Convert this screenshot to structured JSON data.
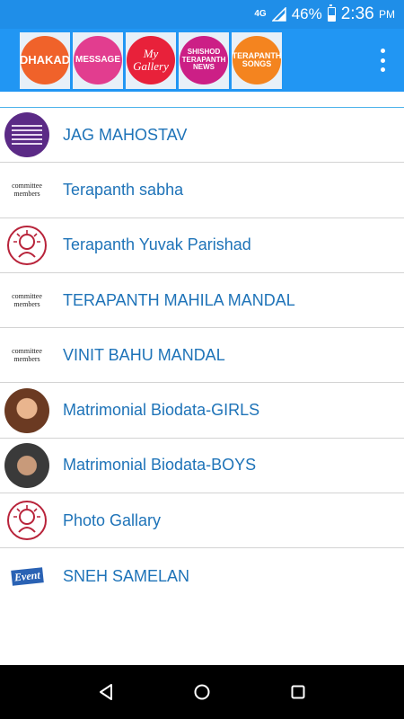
{
  "status_bar": {
    "network": "4G",
    "battery_text": "46%",
    "battery_level": 0.46,
    "time": "2:36",
    "ampm": "PM"
  },
  "tabs": [
    {
      "label": "DHAKAD",
      "color": "#f0622a",
      "icon": "dhakad-tab"
    },
    {
      "label": "MESSAGE",
      "color": "#e23d8f",
      "icon": "message-tab"
    },
    {
      "label": "My Gallery",
      "color": "#e8213a",
      "icon": "gallery-tab"
    },
    {
      "label": "SHISHOD TERAPANTH NEWS",
      "color": "#cc1f86",
      "icon": "news-tab"
    },
    {
      "label": "TERAPANTH SONGS",
      "color": "#f4841f",
      "icon": "songs-tab"
    }
  ],
  "list": [
    {
      "label": "JAG MAHOSTAV",
      "icon": "jag-mahostav-thumb"
    },
    {
      "label": "Terapanth sabha",
      "icon": "committee-members-thumb",
      "thumb_text": "committee members"
    },
    {
      "label": "Terapanth Yuvak Parishad",
      "icon": "terapanth-logo-thumb"
    },
    {
      "label": "TERAPANTH MAHILA MANDAL",
      "icon": "committee-members-thumb",
      "thumb_text": "committee members"
    },
    {
      "label": "VINIT BAHU MANDAL",
      "icon": "committee-members-thumb",
      "thumb_text": "committee members"
    },
    {
      "label": "Matrimonial Biodata-GIRLS",
      "icon": "girl-avatar-thumb"
    },
    {
      "label": "Matrimonial Biodata-BOYS",
      "icon": "boy-avatar-thumb"
    },
    {
      "label": "Photo Gallary",
      "icon": "terapanth-logo-thumb"
    },
    {
      "label": "SNEH SAMELAN",
      "icon": "event-thumb",
      "thumb_text": "Event"
    }
  ],
  "colors": {
    "status_bar": "#1f8ee8",
    "app_bar": "#2196f3",
    "list_text": "#1e73b8",
    "divider": "#4db3ea"
  }
}
